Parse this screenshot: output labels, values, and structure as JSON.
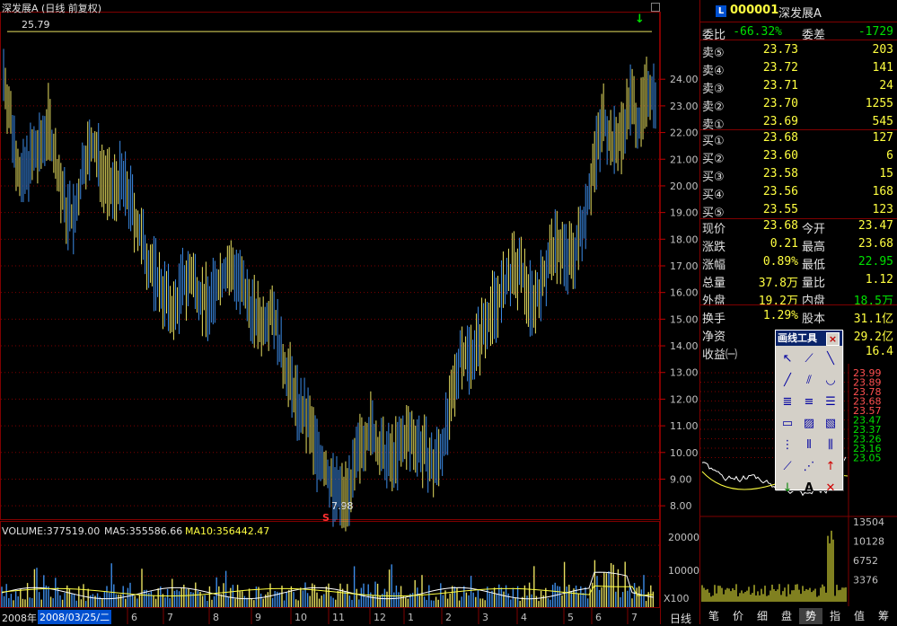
{
  "chart_title": "深发展A (日线 前复权)",
  "chart_data": {
    "type": "candlestick",
    "title": "深发展A (日线 前复权)",
    "price_axis": [
      24.0,
      23.0,
      22.0,
      21.0,
      20.0,
      19.0,
      18.0,
      17.0,
      16.0,
      15.0,
      14.0,
      13.0,
      12.0,
      11.0,
      10.0,
      9.0,
      8.0
    ],
    "price_range": [
      7.5,
      26.5
    ],
    "high_marker": "25.79",
    "low_marker": "7.98",
    "x_month_labels": [
      "2008年",
      "6",
      "7",
      "8",
      "9",
      "10",
      "11",
      "12",
      "1",
      "2",
      "3",
      "4",
      "5",
      "6",
      "7"
    ],
    "close_path": [
      24.2,
      22.0,
      20.1,
      21.0,
      21.3,
      22.4,
      20.6,
      19.0,
      18.7,
      21.0,
      21.5,
      20.6,
      19.8,
      20.2,
      19.6,
      18.4,
      17.3,
      16.6,
      15.9,
      15.2,
      16.3,
      16.6,
      15.9,
      15.5,
      16.4,
      16.9,
      16.7,
      15.8,
      15.2,
      14.8,
      15.6,
      13.6,
      12.7,
      11.6,
      11.2,
      10.0,
      9.3,
      8.5,
      8.3,
      9.0,
      10.4,
      10.9,
      10.0,
      9.7,
      10.0,
      10.6,
      10.5,
      10.0,
      9.4,
      10.2,
      11.7,
      13.8,
      13.6,
      14.1,
      15.1,
      15.6,
      16.2,
      16.9,
      16.6,
      15.6,
      16.2,
      17.4,
      17.8,
      17.2,
      17.6,
      19.1,
      21.0,
      22.6,
      21.5,
      21.9,
      23.3,
      22.3,
      23.7,
      23.4
    ],
    "volume": {
      "label": "VOLUME:377519.00",
      "ma5_label": "MA5:355586.66",
      "ma10_label": "MA10:356442.47",
      "axis": [
        "20000",
        "10000"
      ],
      "unit": "X100"
    },
    "intraday": {
      "axis": [
        "23.99",
        "23.89",
        "23.78",
        "23.68",
        "23.57",
        "23.47",
        "23.37",
        "23.26",
        "23.16",
        "23.05"
      ],
      "volume_axis": [
        "13504",
        "10128",
        "6752",
        "3376"
      ]
    }
  },
  "cursor_date": "2008/03/25/二",
  "period_label": "日线",
  "stock": {
    "badge": "L",
    "code": "000001",
    "name": "深发展A"
  },
  "weibi": {
    "lab1": "委比",
    "v1": "-66.32%",
    "lab2": "委差",
    "v2": "-1729"
  },
  "sell_orders": [
    {
      "label": "卖⑤",
      "price": "23.73",
      "vol": "203"
    },
    {
      "label": "卖④",
      "price": "23.72",
      "vol": "141"
    },
    {
      "label": "卖③",
      "price": "23.71",
      "vol": "24"
    },
    {
      "label": "卖②",
      "price": "23.70",
      "vol": "1255"
    },
    {
      "label": "卖①",
      "price": "23.69",
      "vol": "545"
    }
  ],
  "buy_orders": [
    {
      "label": "买①",
      "price": "23.68",
      "vol": "127"
    },
    {
      "label": "买②",
      "price": "23.60",
      "vol": "6"
    },
    {
      "label": "买③",
      "price": "23.58",
      "vol": "15"
    },
    {
      "label": "买④",
      "price": "23.56",
      "vol": "168"
    },
    {
      "label": "买⑤",
      "price": "23.55",
      "vol": "123"
    }
  ],
  "stats": [
    {
      "l1": "现价",
      "v1": "23.68",
      "l2": "今开",
      "v2": "23.47"
    },
    {
      "l1": "涨跌",
      "v1": "0.21",
      "l2": "最高",
      "v2": "23.68"
    },
    {
      "l1": "涨幅",
      "v1": "0.89%",
      "l2": "最低",
      "v2": "22.95"
    },
    {
      "l1": "总量",
      "v1": "37.8万",
      "l2": "量比",
      "v2": "1.12"
    },
    {
      "l1": "外盘",
      "v1": "19.2万",
      "l2": "内盘",
      "v2": "18.5万"
    },
    {
      "l1": "换手",
      "v1": "1.29%",
      "l2": "股本",
      "v2": "31.1亿"
    },
    {
      "l1": "净资",
      "v1": "",
      "l2": "流通",
      "v2": "29.2亿"
    },
    {
      "l1": "收益㈠",
      "v1": "",
      "l2": "",
      "v2": "16.4"
    }
  ],
  "drawtool": {
    "title": "画线工具",
    "close": "×"
  },
  "bottom_tabs": [
    "笔",
    "价",
    "细",
    "盘",
    "势",
    "指",
    "值",
    "筹"
  ],
  "colors": {
    "up": "#e8e060",
    "down": "#3c8ce8",
    "grid": "#800000",
    "yellow": "#ffff40",
    "green": "#00e000",
    "red": "#ff3030"
  }
}
